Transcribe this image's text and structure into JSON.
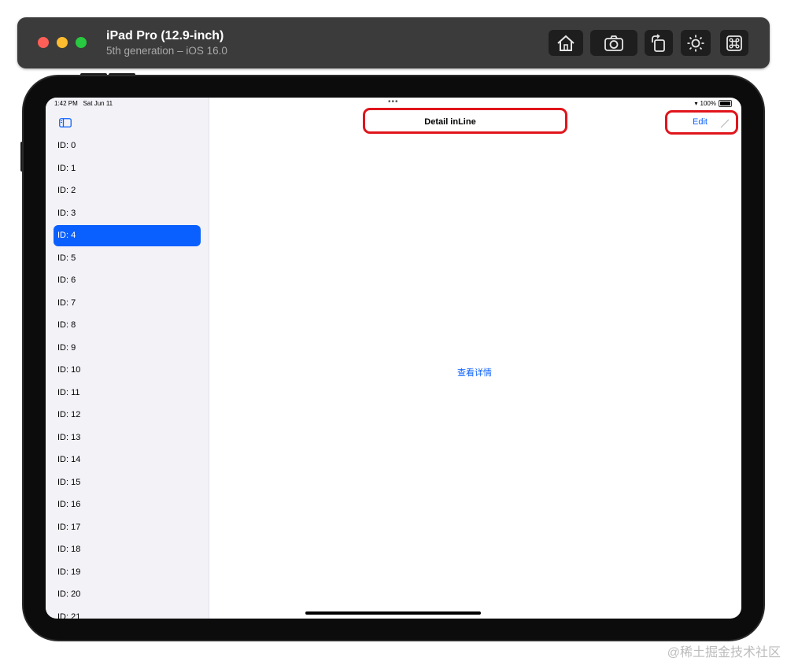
{
  "simulator": {
    "device_name": "iPad Pro (12.9-inch)",
    "device_subtitle": "5th generation – iOS 16.0",
    "toolbar_icons": [
      "home-icon",
      "screenshot-icon",
      "rotate-icon",
      "appearance-icon",
      "command-icon"
    ]
  },
  "status_bar": {
    "time": "1:42 PM",
    "date": "Sat Jun 11",
    "battery": "100%"
  },
  "sidebar": {
    "items": [
      {
        "label": "ID: 0"
      },
      {
        "label": "ID: 1"
      },
      {
        "label": "ID: 2"
      },
      {
        "label": "ID: 3"
      },
      {
        "label": "ID: 4",
        "selected": true
      },
      {
        "label": "ID: 5"
      },
      {
        "label": "ID: 6"
      },
      {
        "label": "ID: 7"
      },
      {
        "label": "ID: 8"
      },
      {
        "label": "ID: 9"
      },
      {
        "label": "ID: 10"
      },
      {
        "label": "ID: 11"
      },
      {
        "label": "ID: 12"
      },
      {
        "label": "ID: 13"
      },
      {
        "label": "ID: 14"
      },
      {
        "label": "ID: 15"
      },
      {
        "label": "ID: 16"
      },
      {
        "label": "ID: 17"
      },
      {
        "label": "ID: 18"
      },
      {
        "label": "ID: 19"
      },
      {
        "label": "ID: 20"
      },
      {
        "label": "ID: 21"
      }
    ]
  },
  "detail": {
    "nav_title": "Detail inLine",
    "edit_label": "Edit",
    "link_text": "查看详情"
  },
  "watermark": "@稀土掘金技术社区",
  "colors": {
    "accent": "#0a60fe",
    "highlight": "#e0151c",
    "sidebar_bg": "#f2f2f7"
  }
}
